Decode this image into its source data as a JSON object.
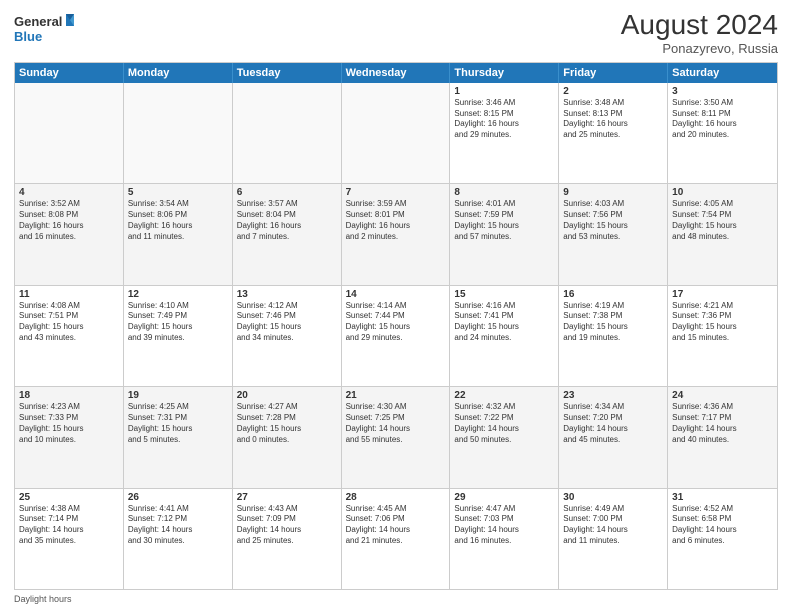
{
  "header": {
    "logo_line1": "General",
    "logo_line2": "Blue",
    "main_title": "August 2024",
    "subtitle": "Ponazyrevo, Russia"
  },
  "days": [
    "Sunday",
    "Monday",
    "Tuesday",
    "Wednesday",
    "Thursday",
    "Friday",
    "Saturday"
  ],
  "rows": [
    [
      {
        "num": "",
        "text": "",
        "empty": true
      },
      {
        "num": "",
        "text": "",
        "empty": true
      },
      {
        "num": "",
        "text": "",
        "empty": true
      },
      {
        "num": "",
        "text": "",
        "empty": true
      },
      {
        "num": "1",
        "text": "Sunrise: 3:46 AM\nSunset: 8:15 PM\nDaylight: 16 hours\nand 29 minutes."
      },
      {
        "num": "2",
        "text": "Sunrise: 3:48 AM\nSunset: 8:13 PM\nDaylight: 16 hours\nand 25 minutes."
      },
      {
        "num": "3",
        "text": "Sunrise: 3:50 AM\nSunset: 8:11 PM\nDaylight: 16 hours\nand 20 minutes."
      }
    ],
    [
      {
        "num": "4",
        "text": "Sunrise: 3:52 AM\nSunset: 8:08 PM\nDaylight: 16 hours\nand 16 minutes."
      },
      {
        "num": "5",
        "text": "Sunrise: 3:54 AM\nSunset: 8:06 PM\nDaylight: 16 hours\nand 11 minutes."
      },
      {
        "num": "6",
        "text": "Sunrise: 3:57 AM\nSunset: 8:04 PM\nDaylight: 16 hours\nand 7 minutes."
      },
      {
        "num": "7",
        "text": "Sunrise: 3:59 AM\nSunset: 8:01 PM\nDaylight: 16 hours\nand 2 minutes."
      },
      {
        "num": "8",
        "text": "Sunrise: 4:01 AM\nSunset: 7:59 PM\nDaylight: 15 hours\nand 57 minutes."
      },
      {
        "num": "9",
        "text": "Sunrise: 4:03 AM\nSunset: 7:56 PM\nDaylight: 15 hours\nand 53 minutes."
      },
      {
        "num": "10",
        "text": "Sunrise: 4:05 AM\nSunset: 7:54 PM\nDaylight: 15 hours\nand 48 minutes."
      }
    ],
    [
      {
        "num": "11",
        "text": "Sunrise: 4:08 AM\nSunset: 7:51 PM\nDaylight: 15 hours\nand 43 minutes."
      },
      {
        "num": "12",
        "text": "Sunrise: 4:10 AM\nSunset: 7:49 PM\nDaylight: 15 hours\nand 39 minutes."
      },
      {
        "num": "13",
        "text": "Sunrise: 4:12 AM\nSunset: 7:46 PM\nDaylight: 15 hours\nand 34 minutes."
      },
      {
        "num": "14",
        "text": "Sunrise: 4:14 AM\nSunset: 7:44 PM\nDaylight: 15 hours\nand 29 minutes."
      },
      {
        "num": "15",
        "text": "Sunrise: 4:16 AM\nSunset: 7:41 PM\nDaylight: 15 hours\nand 24 minutes."
      },
      {
        "num": "16",
        "text": "Sunrise: 4:19 AM\nSunset: 7:38 PM\nDaylight: 15 hours\nand 19 minutes."
      },
      {
        "num": "17",
        "text": "Sunrise: 4:21 AM\nSunset: 7:36 PM\nDaylight: 15 hours\nand 15 minutes."
      }
    ],
    [
      {
        "num": "18",
        "text": "Sunrise: 4:23 AM\nSunset: 7:33 PM\nDaylight: 15 hours\nand 10 minutes."
      },
      {
        "num": "19",
        "text": "Sunrise: 4:25 AM\nSunset: 7:31 PM\nDaylight: 15 hours\nand 5 minutes."
      },
      {
        "num": "20",
        "text": "Sunrise: 4:27 AM\nSunset: 7:28 PM\nDaylight: 15 hours\nand 0 minutes."
      },
      {
        "num": "21",
        "text": "Sunrise: 4:30 AM\nSunset: 7:25 PM\nDaylight: 14 hours\nand 55 minutes."
      },
      {
        "num": "22",
        "text": "Sunrise: 4:32 AM\nSunset: 7:22 PM\nDaylight: 14 hours\nand 50 minutes."
      },
      {
        "num": "23",
        "text": "Sunrise: 4:34 AM\nSunset: 7:20 PM\nDaylight: 14 hours\nand 45 minutes."
      },
      {
        "num": "24",
        "text": "Sunrise: 4:36 AM\nSunset: 7:17 PM\nDaylight: 14 hours\nand 40 minutes."
      }
    ],
    [
      {
        "num": "25",
        "text": "Sunrise: 4:38 AM\nSunset: 7:14 PM\nDaylight: 14 hours\nand 35 minutes."
      },
      {
        "num": "26",
        "text": "Sunrise: 4:41 AM\nSunset: 7:12 PM\nDaylight: 14 hours\nand 30 minutes."
      },
      {
        "num": "27",
        "text": "Sunrise: 4:43 AM\nSunset: 7:09 PM\nDaylight: 14 hours\nand 25 minutes."
      },
      {
        "num": "28",
        "text": "Sunrise: 4:45 AM\nSunset: 7:06 PM\nDaylight: 14 hours\nand 21 minutes."
      },
      {
        "num": "29",
        "text": "Sunrise: 4:47 AM\nSunset: 7:03 PM\nDaylight: 14 hours\nand 16 minutes."
      },
      {
        "num": "30",
        "text": "Sunrise: 4:49 AM\nSunset: 7:00 PM\nDaylight: 14 hours\nand 11 minutes."
      },
      {
        "num": "31",
        "text": "Sunrise: 4:52 AM\nSunset: 6:58 PM\nDaylight: 14 hours\nand 6 minutes."
      }
    ]
  ],
  "footer": "Daylight hours"
}
